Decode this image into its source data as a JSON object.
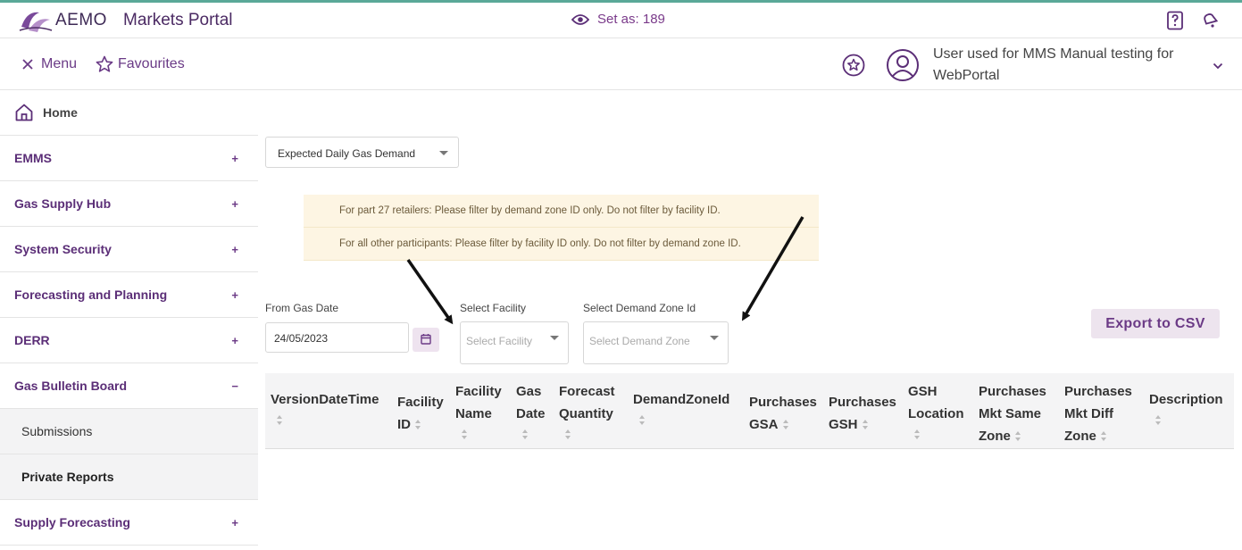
{
  "header": {
    "logo_text": "AEMO",
    "portal_title": "Markets Portal",
    "set_as": "Set as: 189"
  },
  "toolbar": {
    "menu_label": "Menu",
    "favourites_label": "Favourites",
    "user_name": "User used for MMS Manual testing for WebPortal"
  },
  "sidebar": {
    "home": "Home",
    "items": [
      {
        "label": "EMMS",
        "sign": "+"
      },
      {
        "label": "Gas Supply Hub",
        "sign": "+"
      },
      {
        "label": "System Security",
        "sign": "+"
      },
      {
        "label": "Forecasting and Planning",
        "sign": "+"
      },
      {
        "label": "DERR",
        "sign": "+"
      },
      {
        "label": "Gas Bulletin Board",
        "sign": "−"
      }
    ],
    "sub_items": [
      "Submissions",
      "Private Reports"
    ],
    "last_item": {
      "label": "Supply Forecasting",
      "sign": "+"
    }
  },
  "main": {
    "report_select": "Expected Daily Gas Demand",
    "notices": [
      "For part 27 retailers: Please filter by demand zone ID only. Do not filter by facility ID.",
      "For all other participants: Please filter by facility ID only. Do not filter by demand zone ID."
    ],
    "from_gas_date_label": "From Gas Date",
    "from_gas_date_value": "24/05/2023",
    "facility_label": "Select Facility",
    "facility_placeholder": "Select Facility",
    "demand_zone_label": "Select Demand Zone Id",
    "demand_zone_placeholder": "Select Demand Zone",
    "export_label": "Export to CSV"
  },
  "table": {
    "columns": [
      [
        "VersionDateTime"
      ],
      [
        "Facility",
        "ID"
      ],
      [
        "Facility",
        "Name"
      ],
      [
        "Gas",
        "Date"
      ],
      [
        "Forecast",
        "Quantity"
      ],
      [
        "DemandZoneId"
      ],
      [
        "Purchases",
        "GSA"
      ],
      [
        "Purchases",
        "GSH"
      ],
      [
        "GSH",
        "Location"
      ],
      [
        "Purchases",
        "Mkt Same",
        "Zone"
      ],
      [
        "Purchases",
        "Mkt Diff",
        "Zone"
      ],
      [
        "Description"
      ]
    ]
  },
  "colors": {
    "brand_purple": "#5b2e77",
    "accent_teal": "#5aa898",
    "notice_bg": "#fdf5e3"
  }
}
